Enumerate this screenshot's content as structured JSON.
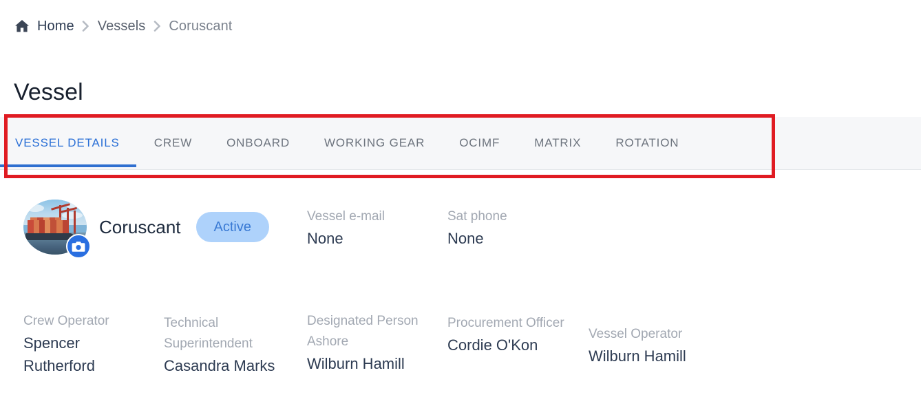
{
  "breadcrumb": {
    "home_label": "Home",
    "items": [
      "Vessels",
      "Coruscant"
    ],
    "separator": "chevron-right"
  },
  "page": {
    "title": "Vessel"
  },
  "tabs": {
    "selected_index": 0,
    "items": [
      {
        "label": "VESSEL DETAILS"
      },
      {
        "label": "CREW"
      },
      {
        "label": "ONBOARD"
      },
      {
        "label": "WORKING GEAR"
      },
      {
        "label": "OCIMF"
      },
      {
        "label": "MATRIX"
      },
      {
        "label": "ROTATION"
      }
    ]
  },
  "annotation": {
    "color": "#e01b22",
    "target": "tab-bar"
  },
  "vessel": {
    "name": "Coruscant",
    "status": "Active",
    "status_bg": "#aed2fb",
    "status_color": "#3a7ad4",
    "avatar_alt": "container-ship-at-port",
    "avatar_action": "change-photo"
  },
  "fields": {
    "vessel_email": {
      "label": "Vessel e-mail",
      "value": "None"
    },
    "sat_phone": {
      "label": "Sat phone",
      "value": "None"
    },
    "crew_operator": {
      "label": "Crew Operator",
      "value": "Spencer Rutherford"
    },
    "technical_superintendent": {
      "label": "Technical Superintendent",
      "value": "Casandra Marks"
    },
    "designated_person_ashore": {
      "label": "Designated Person Ashore",
      "value": "Wilburn Hamill"
    },
    "procurement_officer": {
      "label": "Procurement Officer",
      "value": "Cordie O'Kon"
    },
    "vessel_operator": {
      "label": "Vessel Operator",
      "value": "Wilburn Hamill"
    }
  },
  "theme": {
    "accent": "#2f6fd0",
    "tabbar_bg": "#f6f7f9",
    "text_dark": "#2d3b52",
    "text_muted": "#a2a8b2"
  }
}
